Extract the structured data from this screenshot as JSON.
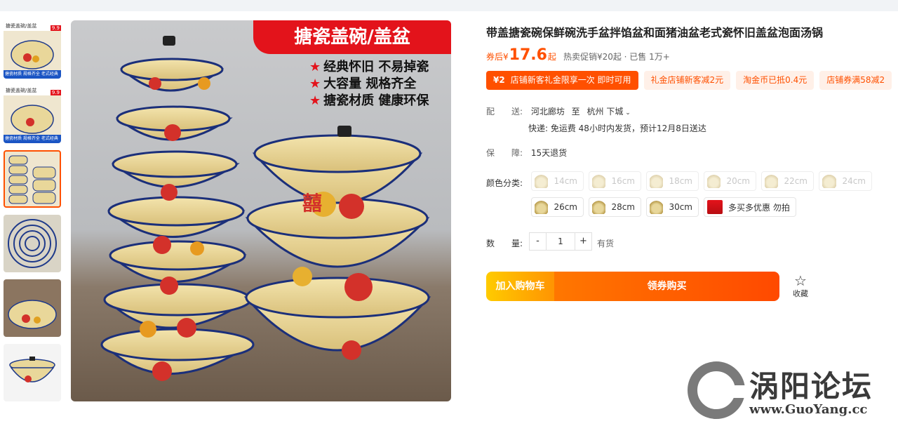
{
  "thumbnails": [
    {
      "caption": "搪瓷盖碗/盖盆",
      "price_tag": "9.9",
      "footer": "搪瓷材质 规格齐全 老式经典"
    },
    {
      "caption": "搪瓷盖碗/盖盆",
      "price_tag": "9.9",
      "footer": "搪瓷材质 规格齐全 老式经典"
    },
    {
      "caption": "",
      "price_tag": "",
      "footer": ""
    },
    {
      "caption": "",
      "price_tag": "",
      "footer": ""
    },
    {
      "caption": "",
      "price_tag": "",
      "footer": ""
    },
    {
      "caption": "",
      "price_tag": "",
      "footer": ""
    }
  ],
  "main_image": {
    "banner": "搪瓷盖碗/盖盆",
    "features": [
      "经典怀旧 不易掉瓷",
      "大容量 规格齐全",
      "搪瓷材质 健康环保"
    ]
  },
  "product": {
    "title": "带盖搪瓷碗保鲜碗洗手盆拌馅盆和面猪油盆老式瓷怀旧盖盆泡面汤锅",
    "price_label": "券后¥",
    "price": "17.6",
    "price_suffix": "起",
    "promo_text": "热卖促销¥20起 · 已售 1万+"
  },
  "coupons": [
    {
      "amount": "¥2",
      "text": "店铺新客礼金限享一次 即时可用"
    },
    {
      "text": "礼金店铺新客减2元"
    },
    {
      "text": "淘金币已抵0.4元"
    },
    {
      "text": "店铺券满58减2"
    }
  ],
  "delivery": {
    "label": "配　　送:",
    "from": "河北廊坊",
    "to_word": "至",
    "to": "杭州 下城",
    "detail": "快递: 免运费  48小时内发货，预计12月8日送达"
  },
  "guarantee": {
    "label": "保　　障:",
    "value": "15天退货"
  },
  "sku": {
    "label": "颜色分类:",
    "options": [
      {
        "text": "14cm",
        "disabled": true
      },
      {
        "text": "16cm",
        "disabled": true
      },
      {
        "text": "18cm",
        "disabled": true
      },
      {
        "text": "20cm",
        "disabled": true
      },
      {
        "text": "22cm",
        "disabled": true
      },
      {
        "text": "24cm",
        "disabled": true
      },
      {
        "text": "26cm",
        "disabled": false
      },
      {
        "text": "28cm",
        "disabled": false
      },
      {
        "text": "30cm",
        "disabled": false
      },
      {
        "text": "多买多优惠 勿拍",
        "disabled": false
      }
    ]
  },
  "quantity": {
    "label": "数　　量:",
    "minus": "-",
    "value": "1",
    "plus": "+",
    "stock": "有货"
  },
  "actions": {
    "add_to_cart": "加入购物车",
    "buy_now": "领券购买",
    "favorite": "收藏"
  },
  "watermark": {
    "name": "涡阳论坛",
    "url": "www.GuoYang.cc"
  }
}
